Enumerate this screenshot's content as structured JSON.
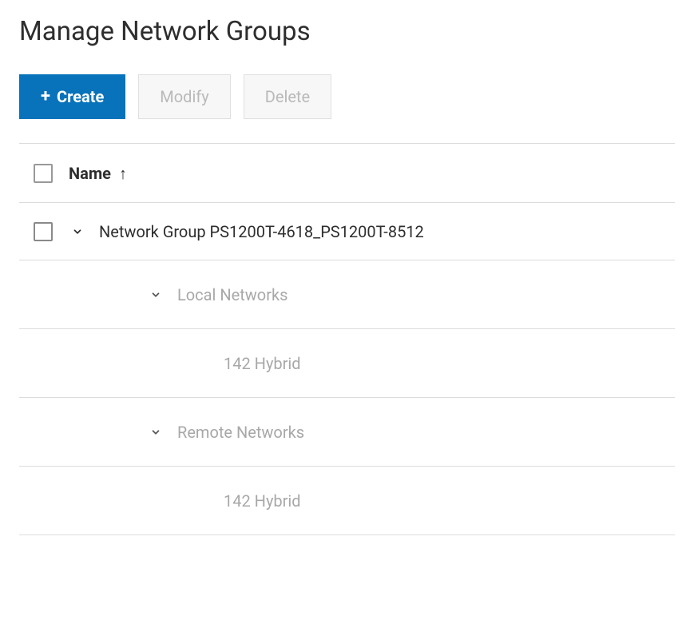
{
  "page": {
    "title": "Manage Network Groups"
  },
  "toolbar": {
    "create_label": "Create",
    "modify_label": "Modify",
    "delete_label": "Delete"
  },
  "table": {
    "column_name_label": "Name",
    "sort_direction": "asc",
    "groups": [
      {
        "name": "Network Group PS1200T-4618_PS1200T-8512",
        "expanded": true,
        "categories": [
          {
            "label": "Local Networks",
            "expanded": true,
            "items": [
              {
                "label": "142 Hybrid"
              }
            ]
          },
          {
            "label": "Remote Networks",
            "expanded": true,
            "items": [
              {
                "label": "142 Hybrid"
              }
            ]
          }
        ]
      }
    ]
  }
}
